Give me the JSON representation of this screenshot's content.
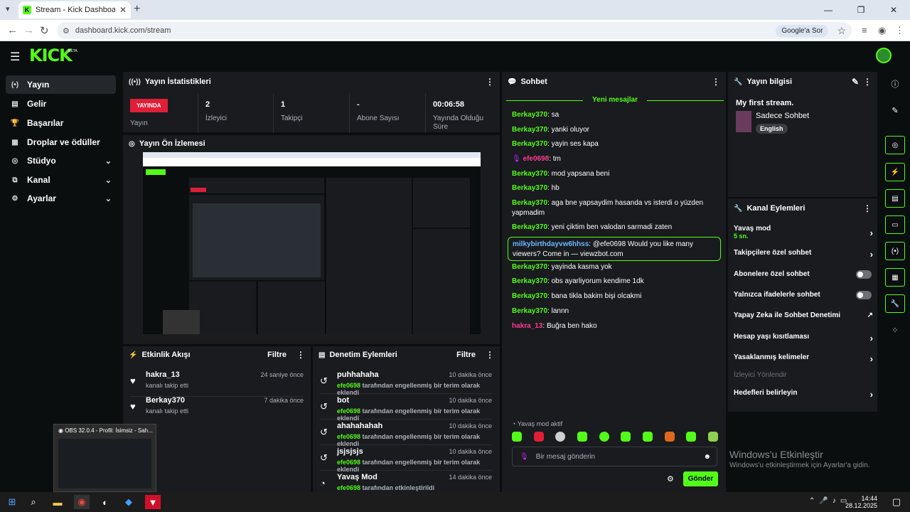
{
  "browser": {
    "tab_title": "Stream - Kick Dashboard",
    "url": "dashboard.kick.com/stream",
    "google_button": "Google'a Sor"
  },
  "app": {
    "logo": "KICK",
    "beta": "BETA"
  },
  "nav": {
    "items": [
      {
        "label": "Yayın",
        "icon": "stream-icon"
      },
      {
        "label": "Gelir",
        "icon": "revenue-icon"
      },
      {
        "label": "Başarılar",
        "icon": "trophy-icon"
      },
      {
        "label": "Droplar ve ödüller",
        "icon": "gift-icon"
      },
      {
        "label": "Stüdyo",
        "icon": "studio-icon"
      },
      {
        "label": "Kanal",
        "icon": "channel-icon"
      },
      {
        "label": "Ayarlar",
        "icon": "settings-icon"
      }
    ]
  },
  "stats": {
    "title": "Yayın İstatistikleri",
    "live_badge": "YAYINDA",
    "live_label": "Yayın",
    "viewers_val": "2",
    "viewers_label": "İzleyici",
    "followers_val": "1",
    "followers_label": "Takipçi",
    "subs_val": "-",
    "subs_label": "Abone Sayısı",
    "uptime_val": "00:06:58",
    "uptime_label": "Yayında Olduğu Süre"
  },
  "preview": {
    "title": "Yayın Ön İzlemesi"
  },
  "activity": {
    "title": "Etkinlik Akışı",
    "filter": "Filtre",
    "items": [
      {
        "name": "hakra_13",
        "sub": "kanalı takip etti",
        "time": "24 saniye önce"
      },
      {
        "name": "Berkay370",
        "sub": "kanalı takip etti",
        "time": "7 dakika önce"
      }
    ]
  },
  "moderation": {
    "title": "Denetim Eylemleri",
    "filter": "Filtre",
    "by_user": "efe0698",
    "items": [
      {
        "name": "puhhahaha",
        "time": "10 dakika önce",
        "sub": "tarafından engellenmiş bir terim olarak eklendi"
      },
      {
        "name": "bot",
        "time": "10 dakika önce",
        "sub": "tarafından engellenmiş bir terim olarak eklendi"
      },
      {
        "name": "ahahahahah",
        "time": "10 dakika önce",
        "sub": "tarafından engellenmiş bir terim olarak eklendi"
      },
      {
        "name": "jsjsjsjs",
        "time": "10 dakika önce",
        "sub": "tarafından engellenmiş bir terim olarak eklendi"
      },
      {
        "name": "Yavaş Mod",
        "time": "14 dakika önce",
        "sub": "tarafından etkinleştirildi"
      }
    ]
  },
  "chat": {
    "title": "Sohbet",
    "new_messages": "Yeni mesajlar",
    "messages": [
      {
        "user": "Berkay370",
        "text": "sa"
      },
      {
        "user": "Berkay370",
        "text": "yanki oluyor"
      },
      {
        "user": "Berkay370",
        "text": "yayin ses kapa"
      },
      {
        "user": "efe0698",
        "text": "tm"
      },
      {
        "user": "Berkay370",
        "text": "mod yapsana beni"
      },
      {
        "user": "Berkay370",
        "text": "hb"
      },
      {
        "user": "Berkay370",
        "text": "aga bne yapsaydim hasanda vs isterdi o yüzden yapmadim"
      },
      {
        "user": "Berkay370",
        "text": "yeni çiktim ben valodan sarmadi zaten"
      },
      {
        "user": "milkybirthdayvw6hhss",
        "text": "@efe0698 Would you like many viewers? Come in — viewzbot.com"
      },
      {
        "user": "Berkay370",
        "text": "yayinda kasma yok"
      },
      {
        "user": "Berkay370",
        "text": "obs ayarliyorum kendime 1dk"
      },
      {
        "user": "Berkay370",
        "text": "bana tikla bakim bişi olcakmi"
      },
      {
        "user": "Berkay370",
        "text": "lannn"
      },
      {
        "user": "hakra_13",
        "text": "Buğra ben hako"
      }
    ],
    "slow_mode": "Yavaş mod aktif",
    "placeholder": "Bir mesaj gönderin",
    "send": "Gönder",
    "colors": {
      "green": "#53fc18",
      "pink": "#ff3b8d",
      "blue": "#6ab7ff",
      "mod_purple": "#c12cff"
    }
  },
  "stream_info": {
    "title": "Yayın bilgisi",
    "stream_title": "My first stream.",
    "category": "Sadece Sohbet",
    "language": "English"
  },
  "channel_actions": {
    "title": "Kanal Eylemleri",
    "slow_mode": "Yavaş mod",
    "slow_mode_val": "5 sn.",
    "followers_only": "Takipçilere özel sohbet",
    "subs_only": "Abonelere özel sohbet",
    "emotes_only": "Yalnızca ifadelerle sohbet",
    "ai_moderation": "Yapay Zeka ile Sohbet Denetimi",
    "age_restrict": "Hesap yaşı kısıtlaması",
    "banned_words": "Yasaklanmış kelimeler",
    "viewer_redirect": "İzleyici Yönlendir",
    "set_goals": "Hedefleri belirleyin"
  },
  "watermark": {
    "line1": "Windows'u Etkinleştir",
    "line2": "Windows'u etkinleştirmek için Ayarlar'a gidin."
  },
  "obs": {
    "title": "OBS 32.0.4 - Profil: İsimsiz - Sah..."
  },
  "taskbar": {
    "time": "14:44",
    "date": "28.12.2025"
  }
}
